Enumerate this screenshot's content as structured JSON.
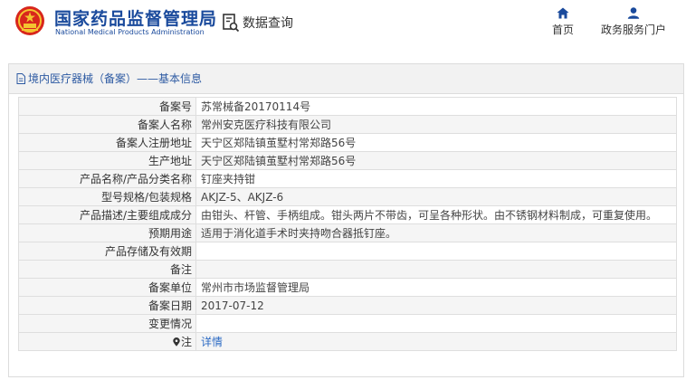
{
  "header": {
    "logo_cn": "国家药品监督管理局",
    "logo_en": "National Medical Products Administration",
    "search_label": "数据查询",
    "nav": [
      {
        "label": "首页",
        "icon": "home-icon"
      },
      {
        "label": "政务服务门户",
        "icon": "user-icon"
      }
    ]
  },
  "panel": {
    "title": "境内医疗器械（备案）——基本信息"
  },
  "rows": [
    {
      "label": "备案号",
      "value": "苏常械备20170114号"
    },
    {
      "label": "备案人名称",
      "value": "常州安克医疗科技有限公司"
    },
    {
      "label": "备案人注册地址",
      "value": "天宁区郑陆镇茧墅村常郑路56号"
    },
    {
      "label": "生产地址",
      "value": "天宁区郑陆镇茧墅村常郑路56号"
    },
    {
      "label": "产品名称/产品分类名称",
      "value": "钉座夹持钳"
    },
    {
      "label": "型号规格/包装规格",
      "value": "AKJZ-5、AKJZ-6"
    },
    {
      "label": "产品描述/主要组成成分",
      "value": "由钳头、杆管、手柄组成。钳头两片不带齿，可呈各种形状。由不锈钢材料制成，可重复使用。"
    },
    {
      "label": "预期用途",
      "value": "适用于消化道手术时夹持吻合器抵钉座。"
    },
    {
      "label": "产品存储及有效期",
      "value": ""
    },
    {
      "label": "备注",
      "value": ""
    },
    {
      "label": "备案单位",
      "value": "常州市市场监督管理局"
    },
    {
      "label": "备案日期",
      "value": "2017-07-12"
    },
    {
      "label": "变更情况",
      "value": ""
    }
  ],
  "note_row": {
    "label": "注",
    "link": "详情"
  },
  "colors": {
    "brand": "#1a4a9c",
    "link": "#2d6bc4",
    "title": "#2d5aa2"
  }
}
